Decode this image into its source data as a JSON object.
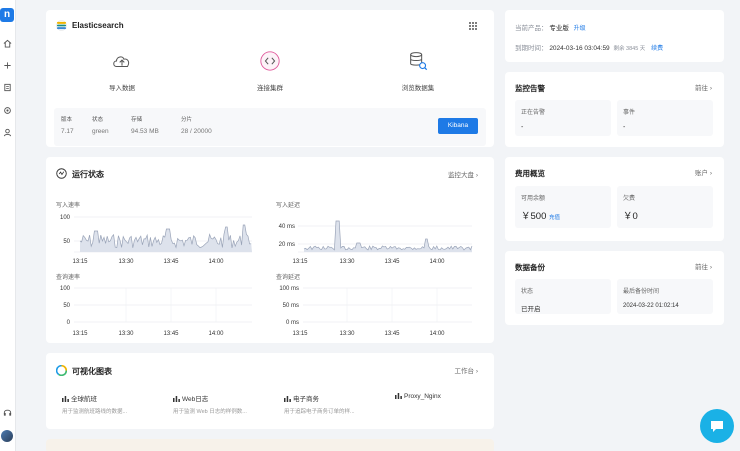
{
  "rail": {
    "logo": "n",
    "icons": [
      "home-icon",
      "plus-icon",
      "list-icon",
      "gear-icon",
      "user-icon",
      "headset-icon",
      "avatar"
    ]
  },
  "elasticsearch": {
    "title": "Elasticsearch",
    "actions": [
      "导入数据",
      "连接集群",
      "浏览数据集"
    ],
    "stats": [
      {
        "label": "版本",
        "value": "7.17"
      },
      {
        "label": "状态",
        "value": "green"
      },
      {
        "label": "存储",
        "value": "94.53 MB"
      },
      {
        "label": "分片",
        "value": "28 / 20000"
      }
    ],
    "kibana": "Kibana"
  },
  "status": {
    "title": "运行状态",
    "more": "监控大盘 ›",
    "charts": {
      "write_rate": {
        "title": "写入速率",
        "yticks": [
          "100",
          "50"
        ],
        "xticks": [
          "13:15",
          "13:30",
          "13:45",
          "14:00"
        ]
      },
      "write_latency": {
        "title": "写入延迟",
        "yticks": [
          "40 ms",
          "20 ms"
        ],
        "xticks": [
          "13:15",
          "13:30",
          "13:45",
          "14:00"
        ]
      },
      "query_rate": {
        "title": "查询速率",
        "yticks": [
          "100",
          "50",
          "0"
        ],
        "xticks": [
          "13:15",
          "13:30",
          "13:45",
          "14:00"
        ]
      },
      "query_latency": {
        "title": "查询延迟",
        "yticks": [
          "100 ms",
          "50 ms",
          "0 ms"
        ],
        "xticks": [
          "13:15",
          "13:30",
          "13:45",
          "14:00"
        ]
      }
    }
  },
  "viz": {
    "title": "可视化图表",
    "more": "工作台 ›",
    "items": [
      {
        "title": "全球航班",
        "desc": "用于监测航班路线的数据..."
      },
      {
        "title": "Web日志",
        "desc": "用于监测 Web 日志的样例数..."
      },
      {
        "title": "电子商务",
        "desc": "用于追踪电子商务订单的样..."
      },
      {
        "title": "Proxy_Nginx",
        "desc": ""
      }
    ]
  },
  "product": {
    "label": "当前产品：",
    "value": "专业版",
    "upgrade": "升级",
    "expire_label": "到期时间：",
    "expire_value": "2024-03-16 03:04:59",
    "remaining": "剩余 3845 天",
    "renew": "续费"
  },
  "alerts": {
    "title": "监控告警",
    "more": "前往 ›",
    "boxes": [
      {
        "label": "正在告警",
        "value": "-"
      },
      {
        "label": "事件",
        "value": "-"
      }
    ]
  },
  "fees": {
    "title": "费用概览",
    "more": "账户 ›",
    "boxes": [
      {
        "label": "可用余额",
        "value": "￥500",
        "action": "充值"
      },
      {
        "label": "欠费",
        "value": "￥0"
      }
    ]
  },
  "backup": {
    "title": "数据备份",
    "more": "前往 ›",
    "boxes": [
      {
        "label": "状态",
        "value": "已开启"
      },
      {
        "label": "最后备份时间",
        "value": "2024-03-22 01:02:14"
      }
    ]
  },
  "colors": {
    "accent": "#1e7ae6",
    "chart_line": "#9aa4b8",
    "chart_fill": "#dde2ec",
    "chat": "#1ab1e6"
  }
}
